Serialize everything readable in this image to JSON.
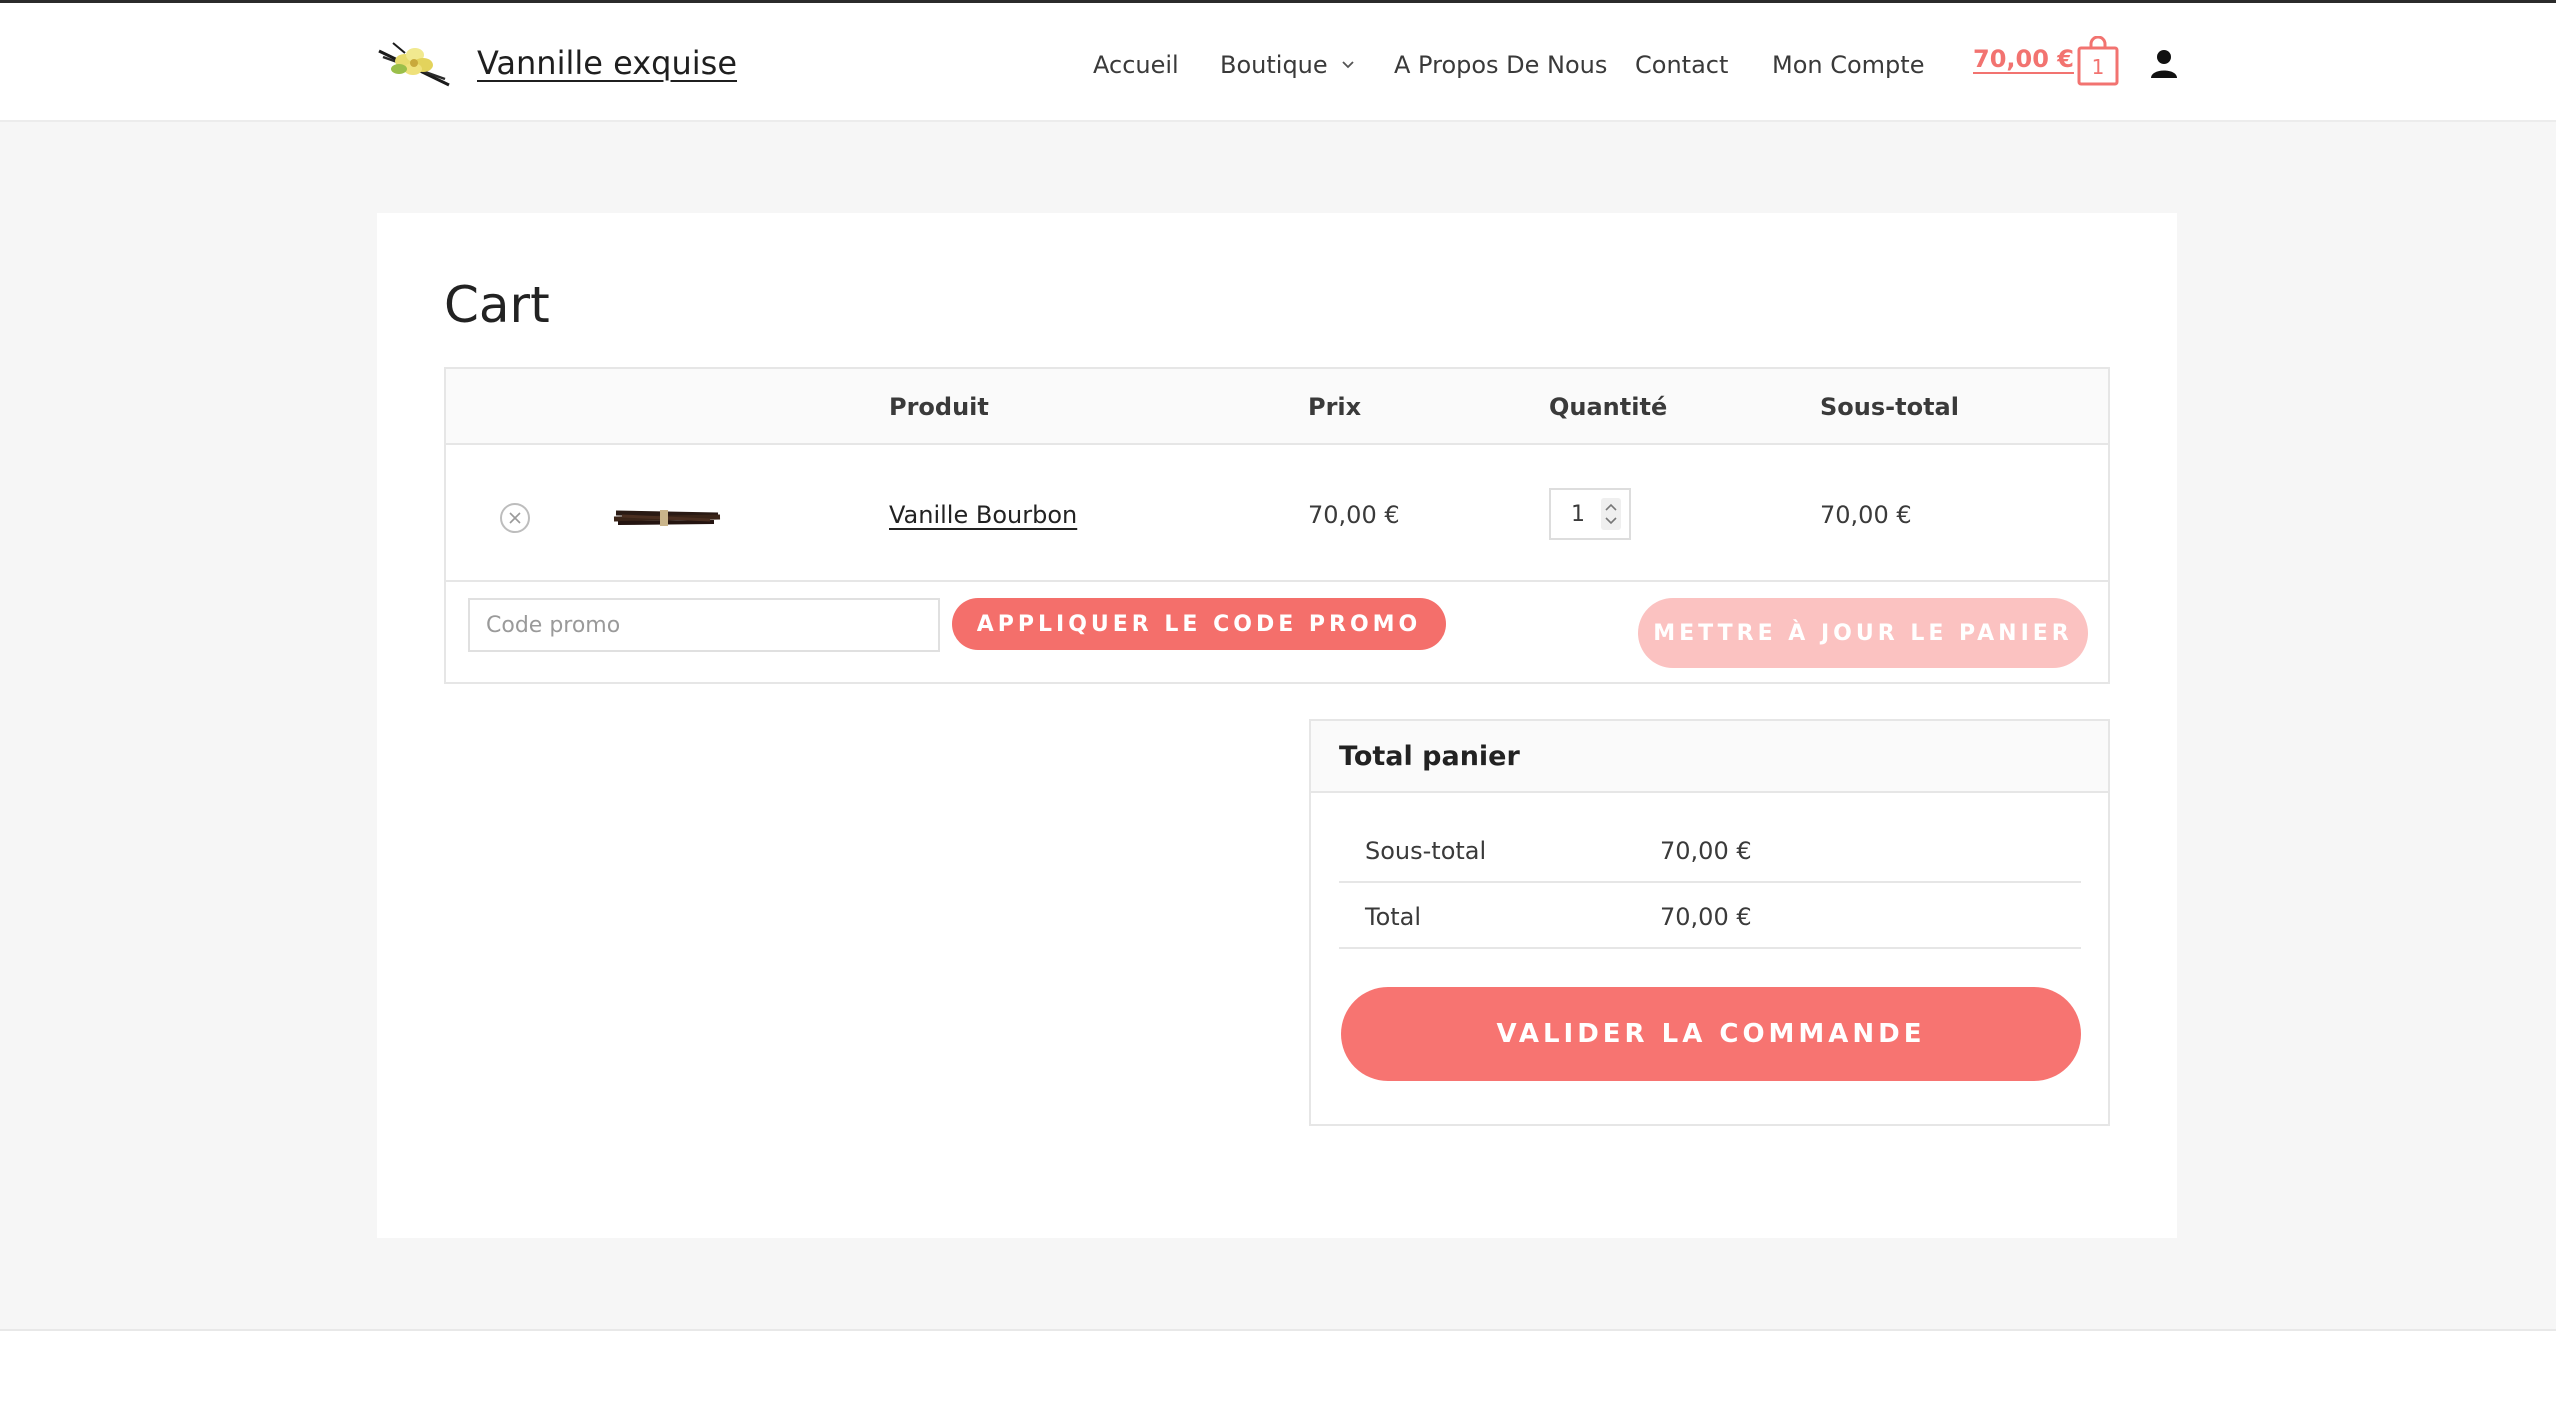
{
  "header": {
    "site_title": "Vannille exquise",
    "nav": [
      {
        "label": "Accueil"
      },
      {
        "label": "Boutique"
      },
      {
        "label": "A Propos De Nous"
      },
      {
        "label": "Contact"
      },
      {
        "label": "Mon Compte"
      }
    ],
    "cart_total": "70,00 €",
    "cart_count": "1"
  },
  "page": {
    "title": "Cart"
  },
  "cart_table": {
    "headers": {
      "product": "Produit",
      "price": "Prix",
      "quantity": "Quantité",
      "subtotal": "Sous-total"
    },
    "items": [
      {
        "name": "Vanille Bourbon",
        "price": "70,00 €",
        "quantity": "1",
        "subtotal": "70,00 €"
      }
    ],
    "promo_placeholder": "Code promo",
    "apply_label": "APPLIQUER LE CODE PROMO",
    "update_label": "METTRE À JOUR LE PANIER"
  },
  "totals": {
    "title": "Total panier",
    "subtotal_label": "Sous-total",
    "subtotal_value": "70,00 €",
    "total_label": "Total",
    "total_value": "70,00 €",
    "checkout_label": "VALIDER LA COMMANDE"
  },
  "colors": {
    "accent": "#f46f6b",
    "accent_light": "#fbc2c1",
    "background": "#f6f6f6"
  }
}
